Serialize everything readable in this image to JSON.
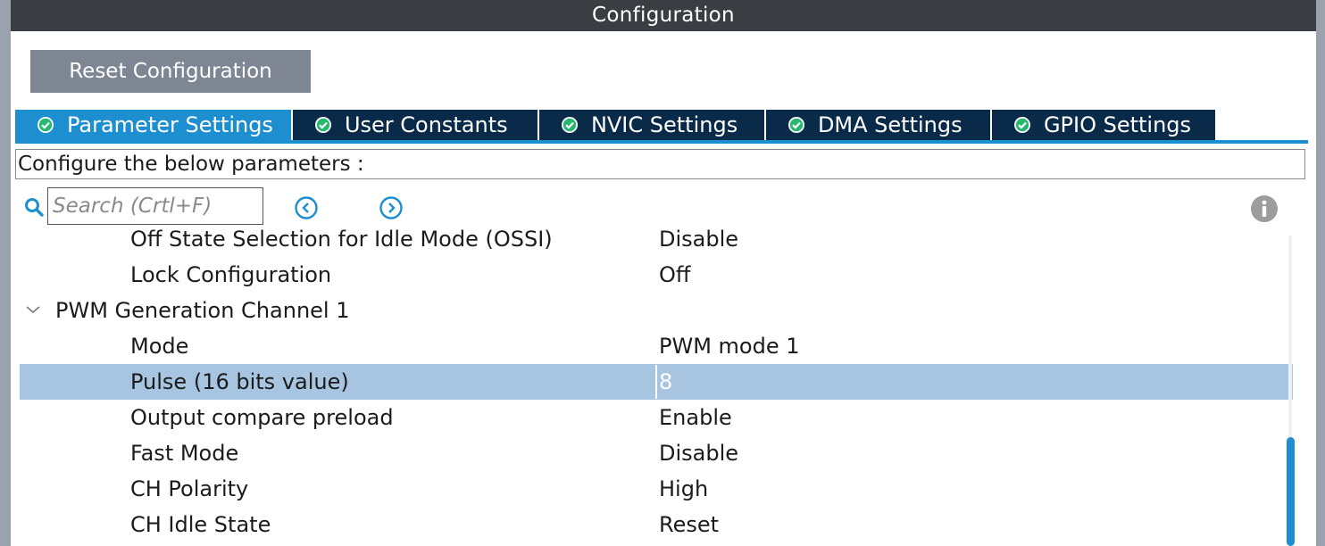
{
  "window": {
    "title": "Configuration"
  },
  "toolbar": {
    "reset_label": "Reset Configuration"
  },
  "tabs": [
    {
      "label": "Parameter Settings",
      "active": true
    },
    {
      "label": "User Constants",
      "active": false
    },
    {
      "label": "NVIC Settings",
      "active": false
    },
    {
      "label": "DMA Settings",
      "active": false
    },
    {
      "label": "GPIO Settings",
      "active": false
    }
  ],
  "description": "Configure the below parameters :",
  "search": {
    "placeholder": "Search (Crtl+F)",
    "value": ""
  },
  "parameters": [
    {
      "name": "Off State Selection for Idle Mode (OSSI)",
      "value": "Disable"
    },
    {
      "name": "Lock Configuration",
      "value": "Off"
    },
    {
      "group": "PWM Generation Channel 1",
      "expanded": true
    },
    {
      "name": "Mode",
      "value": "PWM mode 1"
    },
    {
      "name": "Pulse (16 bits value)",
      "value": "8",
      "selected": true
    },
    {
      "name": "Output compare preload",
      "value": "Enable"
    },
    {
      "name": "Fast Mode",
      "value": "Disable"
    },
    {
      "name": "CH Polarity",
      "value": "High"
    },
    {
      "name": "CH Idle State",
      "value": "Reset"
    }
  ],
  "colors": {
    "accent": "#1d8fd1",
    "tab_inactive": "#0a2a4a",
    "title_bar": "#3a3d41",
    "button": "#7d8692",
    "selection": "#a7c5e0",
    "check_icon": "#27b870"
  },
  "icons": {
    "tab_status": "check-circle-icon",
    "search": "search-icon",
    "prev": "chevron-left-circle-icon",
    "next": "chevron-right-circle-icon",
    "info": "info-icon",
    "group_toggle": "chevron-down-icon"
  }
}
